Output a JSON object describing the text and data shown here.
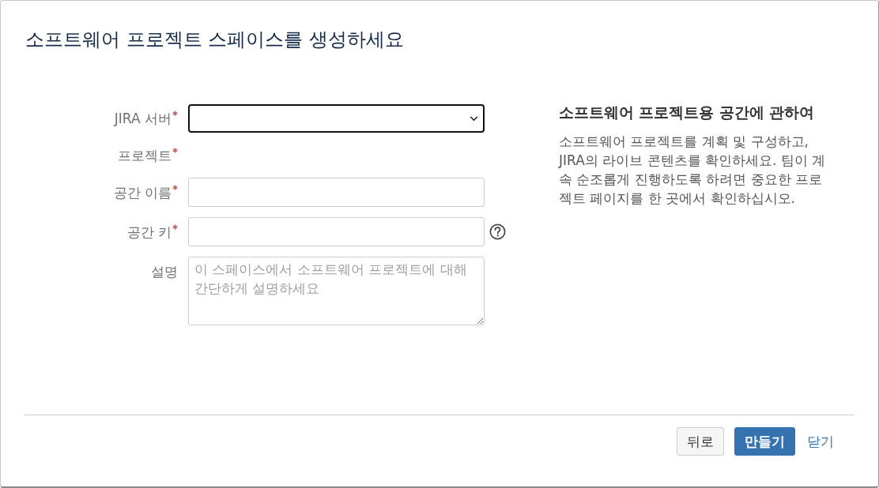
{
  "dialog": {
    "title": "소프트웨어 프로젝트 스페이스를 생성하세요"
  },
  "form": {
    "fields": [
      {
        "kind": "select",
        "label": "JIRA 서버",
        "required": true,
        "focused": true
      },
      {
        "kind": "none",
        "label": "프로젝트",
        "required": true
      },
      {
        "kind": "text",
        "label": "공간 이름",
        "required": true,
        "focused": false
      },
      {
        "kind": "text",
        "label": "공간 키",
        "required": true,
        "focused": false,
        "help": true
      },
      {
        "kind": "textarea",
        "label": "설명",
        "required": false,
        "focused": false,
        "placeholder": "이 스페이스에서 소프트웨어 프로젝트에 대해 간단하게 설명하세요"
      }
    ]
  },
  "info": {
    "heading": "소프트웨어 프로젝트용 공간에 관하여",
    "body": "소프트웨어 프로젝트를 계획 및 구성하고, JIRA의 라이브 콘텐츠를 확인하세요. 팀이 계속 순조롭게 진행하도록 하려면 중요한 프로젝트 페이지를 한 곳에서 확인하십시오."
  },
  "footer": {
    "buttons": [
      {
        "kind": "secondary",
        "label": "뒤로"
      },
      {
        "kind": "primary",
        "label": "만들기"
      },
      {
        "kind": "link",
        "label": "닫기"
      }
    ]
  }
}
